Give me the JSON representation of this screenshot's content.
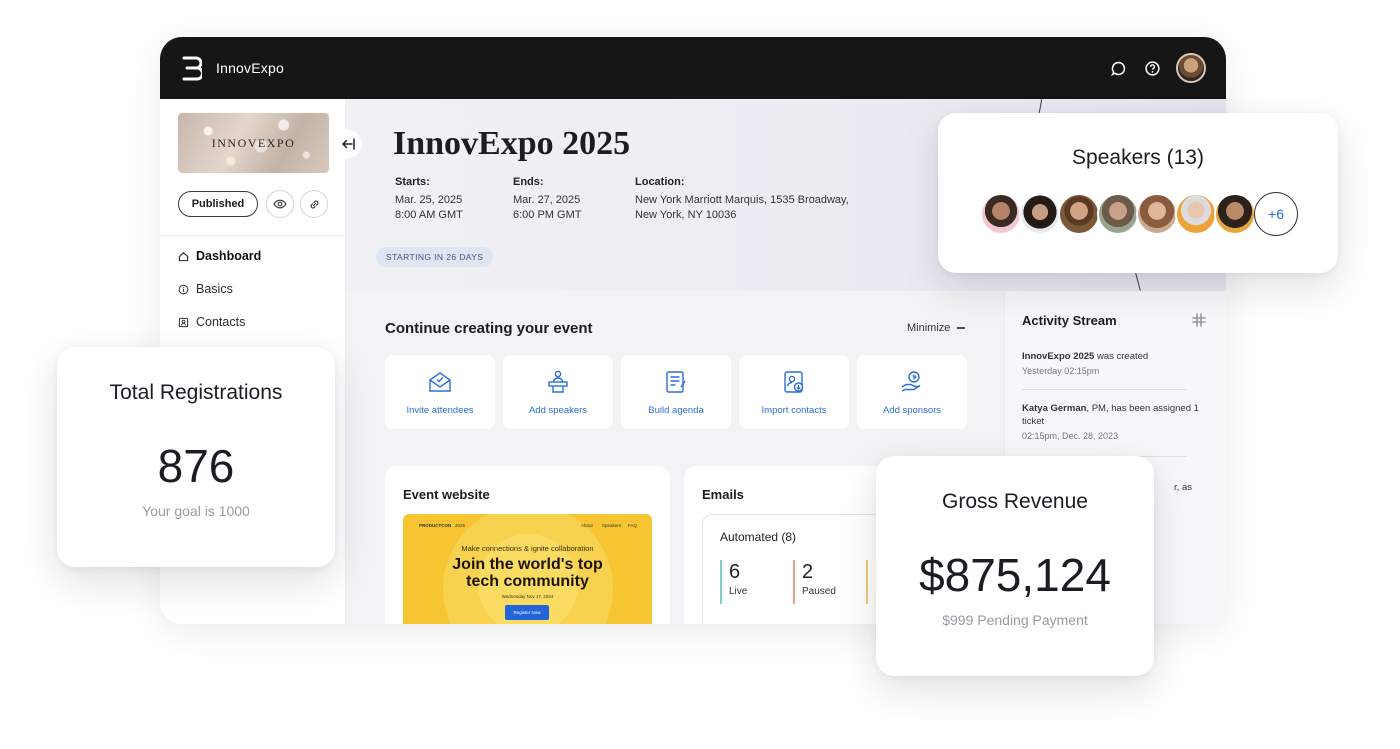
{
  "app": {
    "title": "InnovExpo"
  },
  "sidebar": {
    "thumb_text": "INNOVEXPO",
    "status_label": "Published",
    "items": [
      {
        "label": "Dashboard"
      },
      {
        "label": "Basics"
      },
      {
        "label": "Contacts"
      }
    ]
  },
  "event": {
    "title": "InnovExpo 2025",
    "starts_label": "Starts:",
    "starts_date": "Mar. 25, 2025",
    "starts_time": "8:00 AM GMT",
    "ends_label": "Ends:",
    "ends_date": "Mar. 27, 2025",
    "ends_time": "6:00 PM GMT",
    "location_label": "Location:",
    "location_line1": "New York Marriott Marquis, 1535 Broadway,",
    "location_line2": "New York, NY 10036",
    "countdown": "STARTING IN 26 DAYS"
  },
  "continue": {
    "title": "Continue creating your event",
    "minimize_label": "Minimize",
    "actions": [
      {
        "label": "Invite attendees",
        "icon": "envelope-icon"
      },
      {
        "label": "Add speakers",
        "icon": "podium-speaker-icon"
      },
      {
        "label": "Build agenda",
        "icon": "agenda-notepad-icon"
      },
      {
        "label": "Import contacts",
        "icon": "import-contacts-icon"
      },
      {
        "label": "Add sponsors",
        "icon": "sponsor-money-icon"
      }
    ]
  },
  "website": {
    "title": "Event website",
    "preview": {
      "brand": "PRODUCTCON",
      "brand_year": "2025",
      "nav": [
        "About",
        "Speakers",
        "FAQ"
      ],
      "subtitle": "Make connections & ignite collaboration",
      "headline_1": "Join the world's top",
      "headline_2": "tech community",
      "date": "Wednesday Nov 17, 2024",
      "button": "Register Now"
    }
  },
  "emails": {
    "title": "Emails",
    "automated_label": "Automated (8)",
    "stats": [
      {
        "value": "6",
        "label": "Live",
        "color": "#7fd1c6"
      },
      {
        "value": "2",
        "label": "Paused",
        "color": "#e8a08a"
      }
    ]
  },
  "activity": {
    "title": "Activity Stream",
    "items": [
      {
        "bold": "InnovExpo 2025",
        "text": " was created",
        "time": "Yesterday 02:15pm"
      },
      {
        "bold": "Katya German",
        "text": ", PM, has been assigned 1 ticket",
        "time": "02:15pm, Dec. 28, 2023"
      },
      {
        "partial": "r, as"
      }
    ]
  },
  "speakers": {
    "title": "Speakers (13)",
    "more": "+6"
  },
  "registrations": {
    "title": "Total Registrations",
    "value": "876",
    "goal": "Your goal is 1000"
  },
  "revenue": {
    "title": "Gross Revenue",
    "value": "$875,124",
    "pending": "$999 Pending Payment"
  },
  "colors": {
    "accent": "#2a6fd6",
    "topbar": "#161617",
    "website_yellow": "#f6c531"
  }
}
